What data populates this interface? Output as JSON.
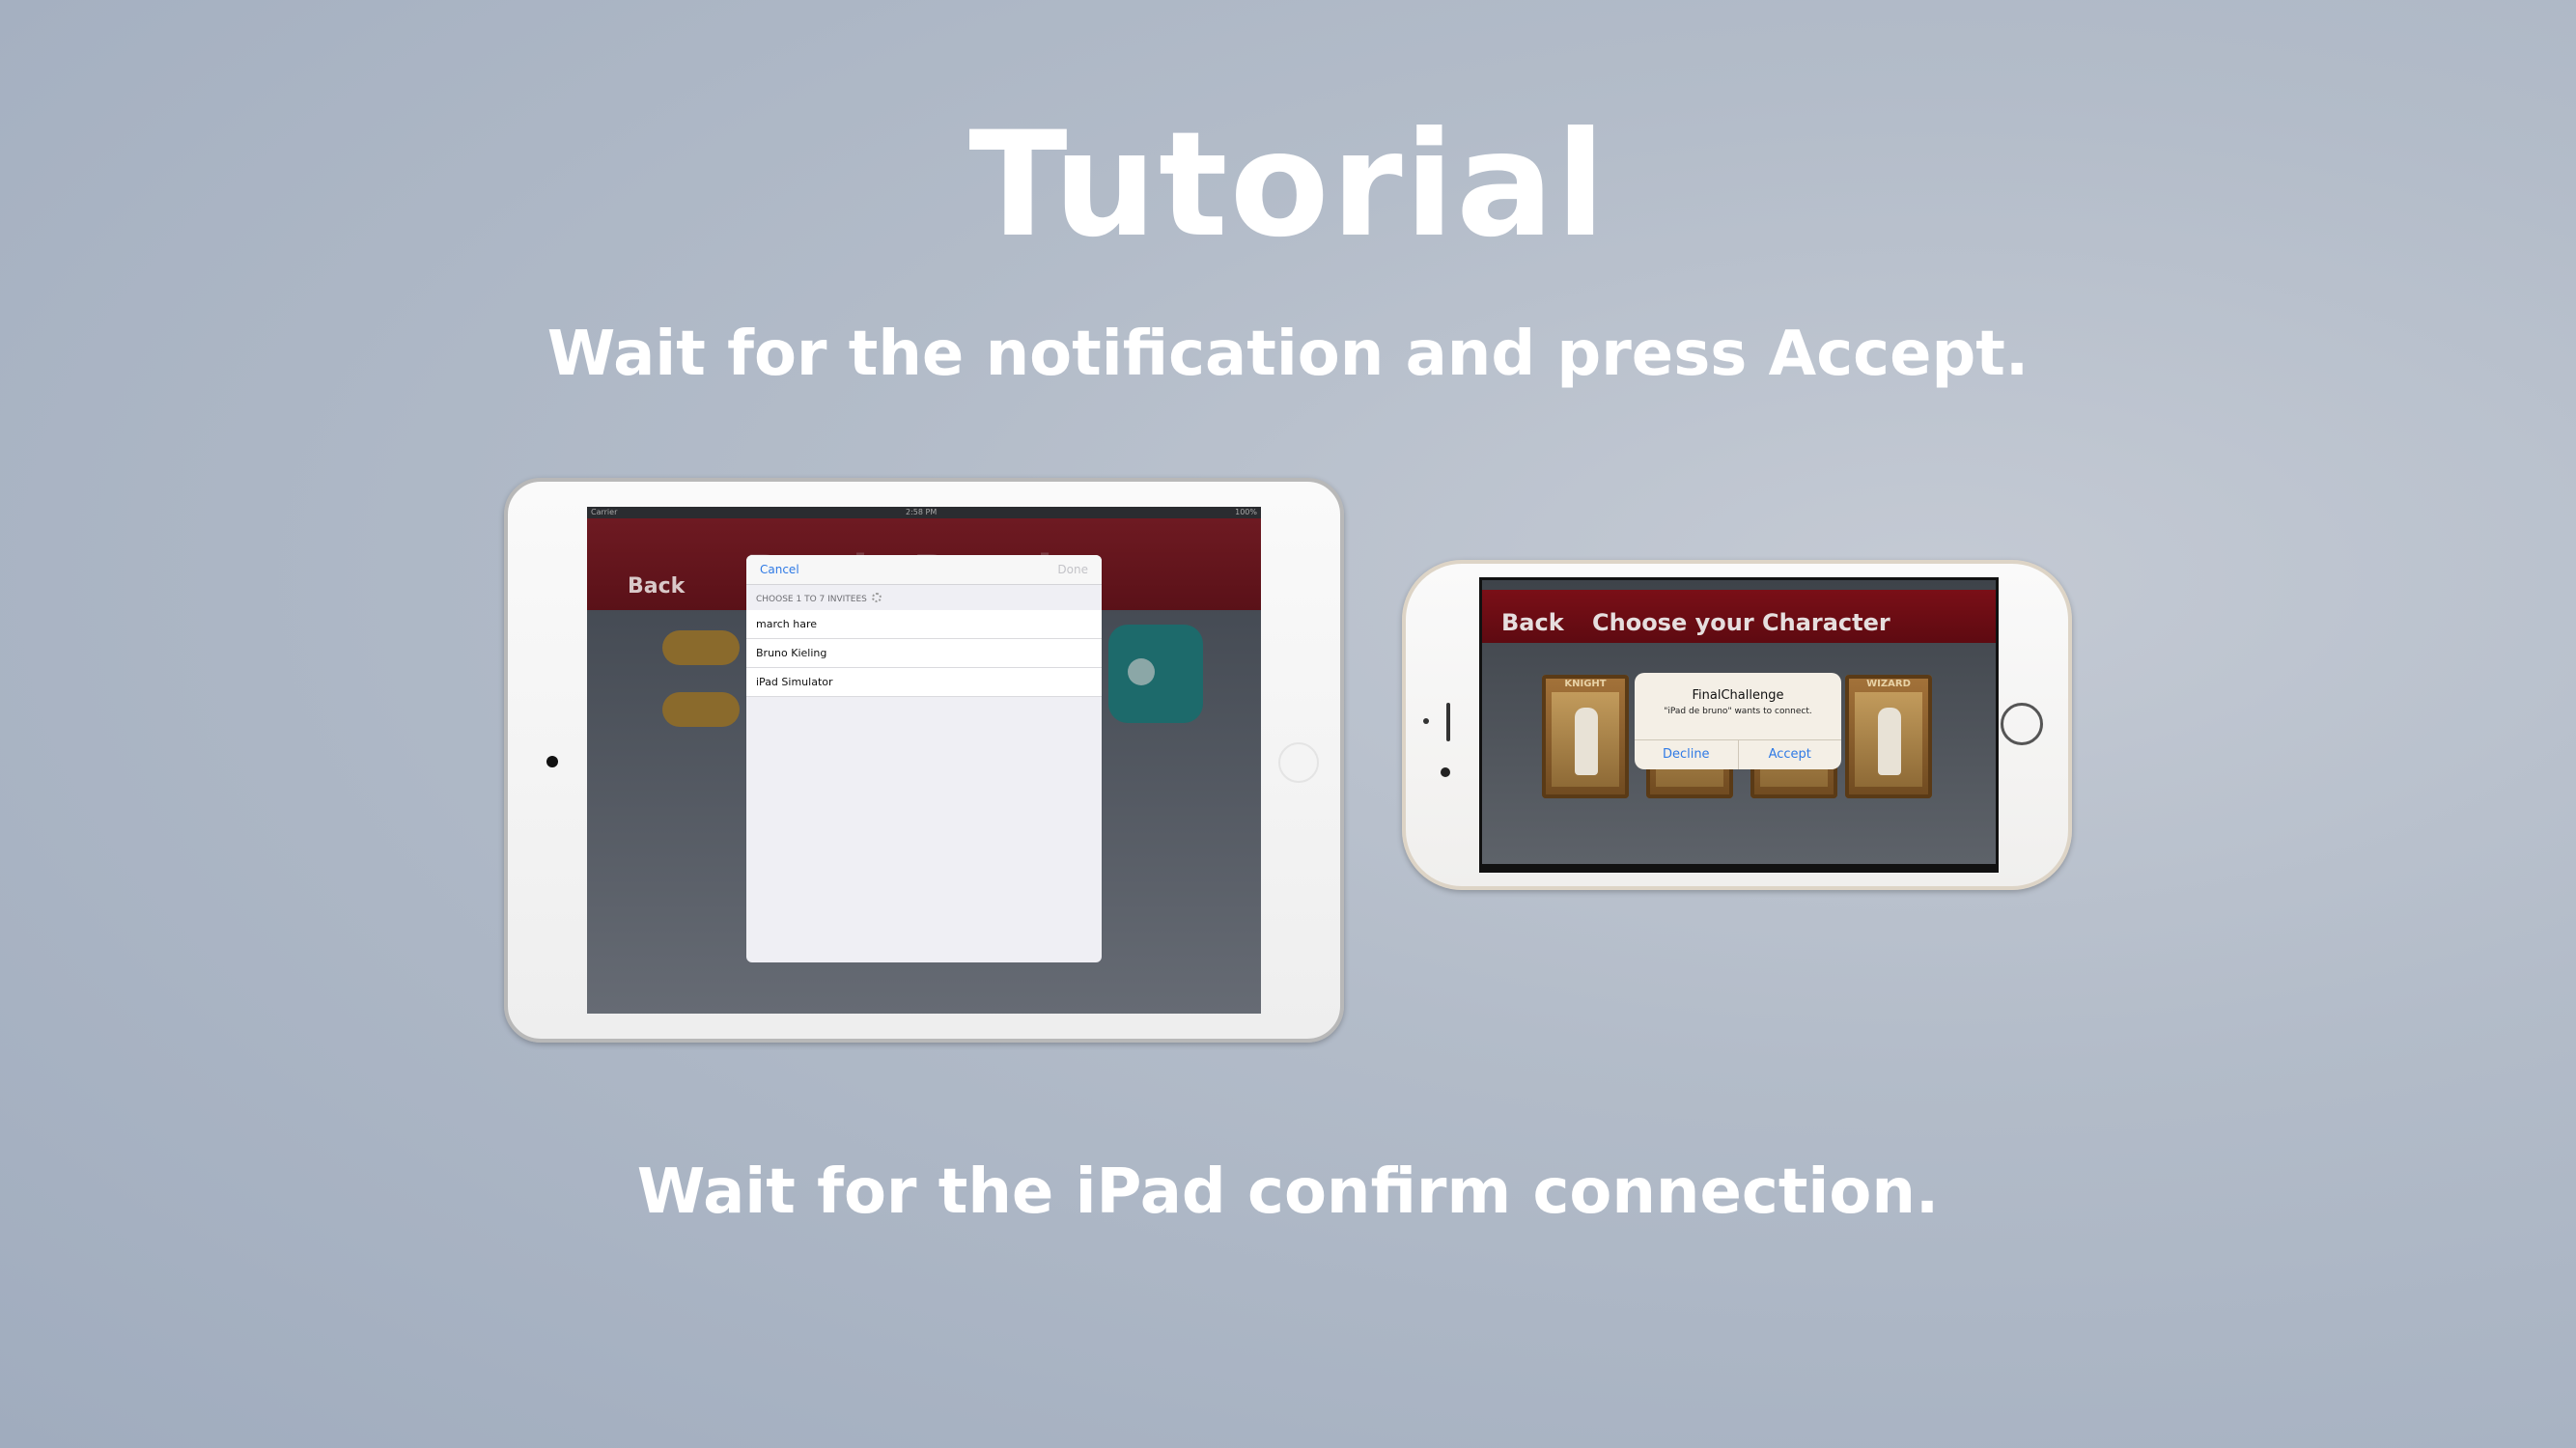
{
  "title": "Tutorial",
  "subtitle_top": "Wait for the notification and press Accept.",
  "subtitle_bottom": "Wait for the iPad confirm connection.",
  "ipad": {
    "status": {
      "carrier": "Carrier",
      "time": "2:58 PM",
      "battery": "100%"
    },
    "back_label": "Back",
    "bg_title": "Battle Royale",
    "sheet": {
      "cancel": "Cancel",
      "done": "Done",
      "section": "CHOOSE 1 TO 7 INVITEES",
      "invitees": [
        "march hare",
        "Bruno Kieling",
        "iPad Simulator"
      ]
    }
  },
  "iphone": {
    "back_label": "Back",
    "title": "Choose your Character",
    "cards": [
      "KNIGHT",
      "",
      "",
      "WIZARD"
    ],
    "alert": {
      "title": "FinalChallenge",
      "message": "\"iPad de bruno\" wants to connect.",
      "decline": "Decline",
      "accept": "Accept"
    }
  }
}
